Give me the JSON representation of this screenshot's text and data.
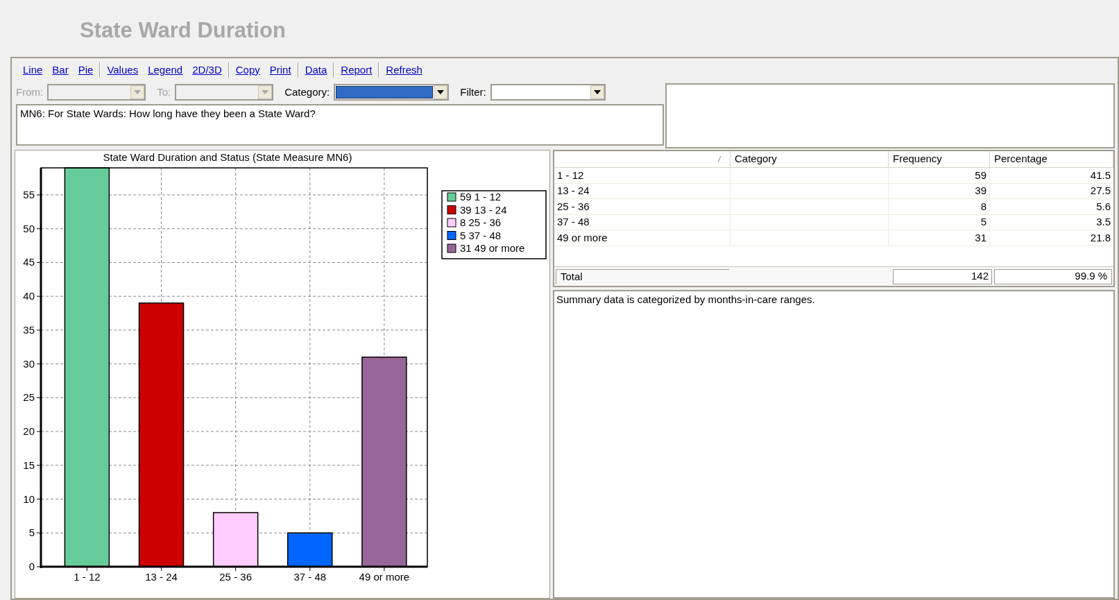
{
  "window": {
    "title": "State Ward Duration"
  },
  "toolbar_groups": [
    [
      "Line",
      "Bar",
      "Pie"
    ],
    [
      "Values",
      "Legend",
      "2D/3D"
    ],
    [
      "Copy",
      "Print"
    ],
    [
      "Data"
    ],
    [
      "Report"
    ],
    [
      "Refresh"
    ]
  ],
  "filters": [
    {
      "label": "From:",
      "disabled": true,
      "selected": false
    },
    {
      "label": "To:",
      "disabled": true,
      "selected": false
    },
    {
      "label": "Category:",
      "disabled": false,
      "selected": true
    },
    {
      "label": "Filter:",
      "disabled": false,
      "selected": false
    }
  ],
  "question": "MN6: For State Wards:  How long have they been a State Ward?",
  "chart": {
    "chart_data": {
      "type": "bar",
      "title": "State Ward Duration and Status (State Measure MN6)",
      "categories": [
        "1 - 12",
        "13 - 24",
        "25 - 36",
        "37 - 48",
        "49 or more"
      ],
      "grid": true,
      "legend": "right",
      "ylim": [
        0,
        59
      ],
      "yticks": [
        0,
        5,
        10,
        15,
        20,
        25,
        30,
        35,
        40,
        45,
        50,
        55
      ],
      "series": [
        {
          "name": "59 1 - 12",
          "color": "#66cc99",
          "values": [
            59,
            null,
            null,
            null,
            null
          ]
        },
        {
          "name": "39 13 - 24",
          "color": "#cc0000",
          "values": [
            null,
            39,
            null,
            null,
            null
          ]
        },
        {
          "name": "8 25 - 36",
          "color": "#ffccff",
          "values": [
            null,
            null,
            8,
            null,
            null
          ]
        },
        {
          "name": "5 37 - 48",
          "color": "#0066ff",
          "values": [
            null,
            null,
            null,
            5,
            null
          ]
        },
        {
          "name": "31 49 or more",
          "color": "#996699",
          "values": [
            null,
            null,
            null,
            null,
            31
          ]
        }
      ]
    }
  },
  "table": {
    "columns": [
      "Category",
      "Frequency",
      "Percentage"
    ],
    "rows": [
      {
        "range": "1 - 12",
        "frequency": "59",
        "percentage": "41.5"
      },
      {
        "range": "13 - 24",
        "frequency": "39",
        "percentage": "27.5"
      },
      {
        "range": "25 - 36",
        "frequency": "8",
        "percentage": "5.6"
      },
      {
        "range": "37 - 48",
        "frequency": "5",
        "percentage": "3.5"
      },
      {
        "range": "49 or more",
        "frequency": "31",
        "percentage": "21.8"
      }
    ],
    "total": {
      "label": "Total",
      "frequency": "142",
      "percentage": "99.9 %"
    }
  },
  "summary": "Summary data is categorized by months-in-care ranges."
}
